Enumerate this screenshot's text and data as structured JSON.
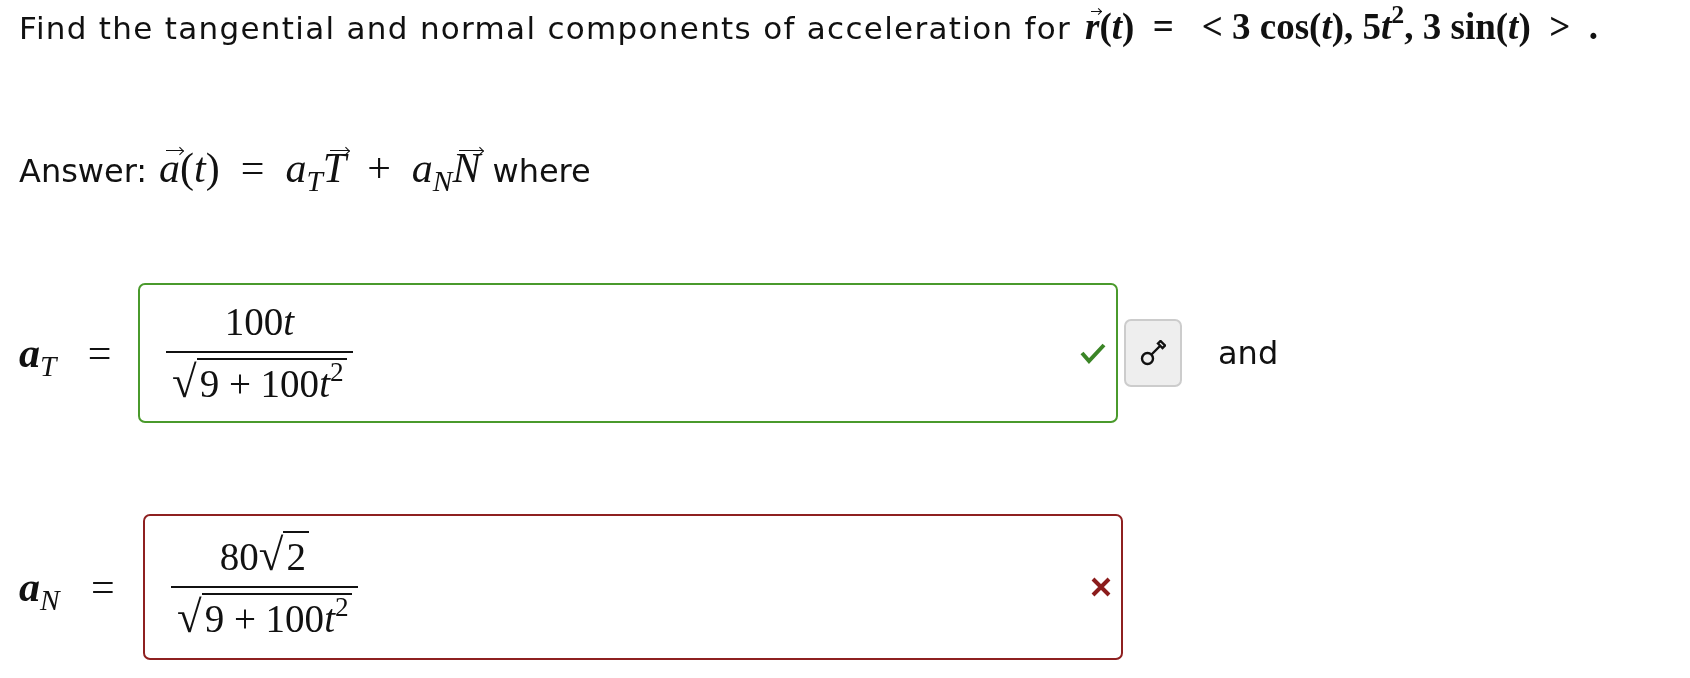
{
  "prompt": {
    "text": "Find the tangential and normal components of acceleration for",
    "formula": [
      {
        "kind": "vec",
        "text": "r"
      },
      {
        "kind": "sym",
        "text": "("
      },
      {
        "kind": "var",
        "text": "t"
      },
      {
        "kind": "sym",
        "text": ")  =   < 3 cos("
      },
      {
        "kind": "var",
        "text": "t"
      },
      {
        "kind": "sym",
        "text": "), 5"
      },
      {
        "kind": "var",
        "text": "t"
      },
      {
        "kind": "sym",
        "text": "$^{2}$, 3 sin("
      },
      {
        "kind": "var",
        "text": "t"
      },
      {
        "kind": "sym",
        "text": ")  >  ."
      }
    ]
  },
  "answer_line": {
    "lead": "Answer:",
    "formula": [
      {
        "kind": "vec",
        "text": "a"
      },
      {
        "kind": "sym",
        "text": "("
      },
      {
        "kind": "var",
        "text": "t"
      },
      {
        "kind": "sym",
        "text": ")  =  "
      },
      {
        "kind": "var",
        "text": "a$_{T}$"
      },
      {
        "kind": "vec",
        "text": "T"
      },
      {
        "kind": "sym",
        "text": "  +  "
      },
      {
        "kind": "var",
        "text": "a$_{N}$"
      },
      {
        "kind": "vec",
        "text": "N"
      }
    ],
    "tail": "where"
  },
  "answers": [
    {
      "label": [
        {
          "kind": "var",
          "text": "a$_{T}$"
        },
        {
          "kind": "sym",
          "text": "   ="
        }
      ],
      "numerator": {
        "before": [
          {
            "kind": "sym",
            "text": "100"
          },
          {
            "kind": "var",
            "text": "t"
          }
        ]
      },
      "denominator": {
        "radical": "√",
        "radicand": [
          {
            "kind": "sym",
            "text": "9 + 100"
          },
          {
            "kind": "var",
            "text": "t"
          },
          {
            "kind": "sym",
            "text": "$^{2}$"
          }
        ]
      },
      "correct": true,
      "key_button": true,
      "suffix": "and"
    },
    {
      "label": [
        {
          "kind": "var",
          "text": "a$_{N}$"
        },
        {
          "kind": "sym",
          "text": "   ="
        }
      ],
      "numerator": {
        "before": [
          {
            "kind": "sym",
            "text": "80"
          }
        ],
        "radical": "√",
        "radicand": [
          {
            "kind": "sym",
            "text": "2"
          }
        ]
      },
      "denominator": {
        "radical": "√",
        "radicand": [
          {
            "kind": "sym",
            "text": "9 + 100"
          },
          {
            "kind": "var",
            "text": "t"
          },
          {
            "kind": "sym",
            "text": "$^{2}$"
          }
        ]
      },
      "correct": false,
      "key_button": false
    }
  ]
}
